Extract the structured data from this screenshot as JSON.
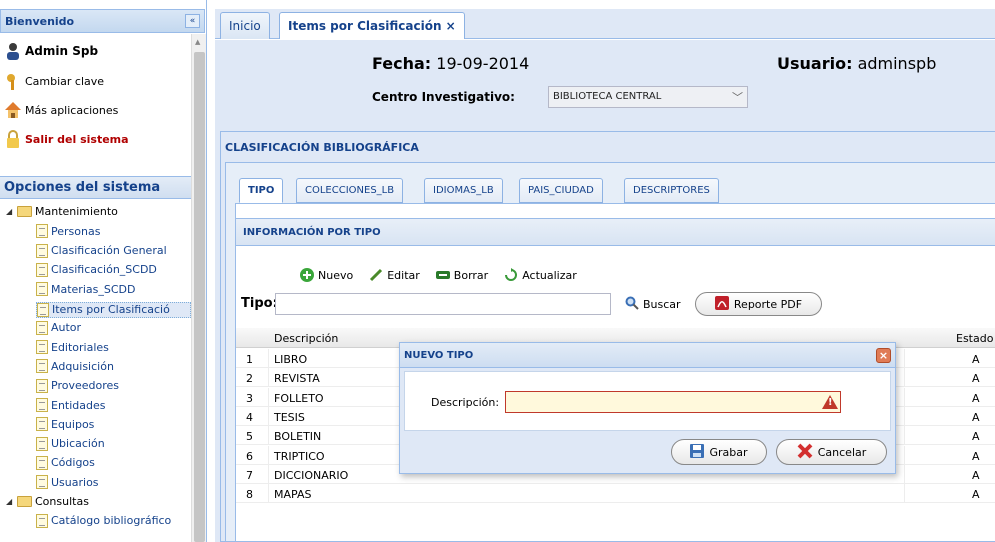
{
  "sidebar": {
    "title": "Bienvenido",
    "collapse": "«",
    "user": "Admin Spb",
    "cambiar": "Cambiar clave",
    "mas": "Más aplicaciones",
    "salir": "Salir del sistema",
    "opciones": "Opciones del sistema",
    "tree": [
      {
        "label": "Mantenimiento",
        "type": "folder"
      },
      {
        "label": "Personas",
        "type": "leaf"
      },
      {
        "label": "Clasificación General",
        "type": "leaf"
      },
      {
        "label": "Clasificación_SCDD",
        "type": "leaf"
      },
      {
        "label": "Materias_SCDD",
        "type": "leaf"
      },
      {
        "label": "Items por Clasificació",
        "type": "leaf"
      },
      {
        "label": "Autor",
        "type": "leaf"
      },
      {
        "label": "Editoriales",
        "type": "leaf"
      },
      {
        "label": "Adquisición",
        "type": "leaf"
      },
      {
        "label": "Proveedores",
        "type": "leaf"
      },
      {
        "label": "Entidades",
        "type": "leaf"
      },
      {
        "label": "Equipos",
        "type": "leaf"
      },
      {
        "label": "Ubicación",
        "type": "leaf"
      },
      {
        "label": "Códigos",
        "type": "leaf"
      },
      {
        "label": "Usuarios",
        "type": "leaf"
      },
      {
        "label": "Consultas",
        "type": "folder"
      },
      {
        "label": "Catálogo bibliográfico",
        "type": "leaf"
      }
    ]
  },
  "tabs": {
    "inicio": "Inicio",
    "items": "Items por Clasificación ×"
  },
  "header": {
    "fecha_label": "Fecha:",
    "fecha": "19-09-2014",
    "usuario_label": "Usuario:",
    "usuario": "adminspb",
    "centro_label": "Centro Investigativo:",
    "centro": "BIBLIOTECA CENTRAL"
  },
  "clasif_title": "CLASIFICACIÓN BIBLIOGRÁFICA",
  "subtabs": [
    "TIPO",
    "COLECCIONES_LB",
    "IDIOMAS_LB",
    "PAIS_CIUDAD",
    "DESCRIPTORES"
  ],
  "info_title": "INFORMACIÓN POR TIPO",
  "toolbar": {
    "nuevo": "Nuevo",
    "editar": "Editar",
    "borrar": "Borrar",
    "actualizar": "Actualizar"
  },
  "search": {
    "label": "Tipo:",
    "buscar": "Buscar",
    "reporte": "Reporte PDF"
  },
  "grid": {
    "col_desc": "Descripción",
    "col_estado": "Estado",
    "rows": [
      {
        "n": "1",
        "desc": "LIBRO",
        "estado": "A"
      },
      {
        "n": "2",
        "desc": "REVISTA",
        "estado": "A"
      },
      {
        "n": "3",
        "desc": "FOLLETO",
        "estado": "A"
      },
      {
        "n": "4",
        "desc": "TESIS",
        "estado": "A"
      },
      {
        "n": "5",
        "desc": "BOLETIN",
        "estado": "A"
      },
      {
        "n": "6",
        "desc": "TRIPTICO",
        "estado": "A"
      },
      {
        "n": "7",
        "desc": "DICCIONARIO",
        "estado": "A"
      },
      {
        "n": "8",
        "desc": "MAPAS",
        "estado": "A"
      }
    ]
  },
  "modal": {
    "title": "NUEVO TIPO",
    "close": "×",
    "desc_label": "Descripción:",
    "warn": "!",
    "grabar": "Grabar",
    "cancelar": "Cancelar"
  },
  "colors": {
    "panel": "#dfe8f6",
    "header_text": "#15428b",
    "salir": "#b00000"
  }
}
